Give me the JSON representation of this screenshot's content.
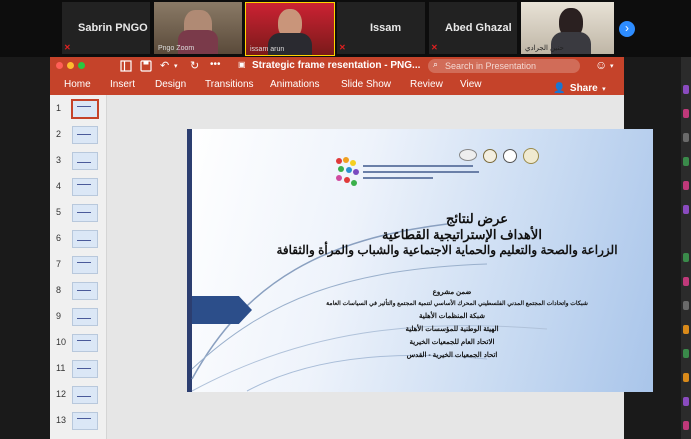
{
  "zoom": {
    "participants": [
      {
        "name": "Sabrin PNGO",
        "video": false
      },
      {
        "name": "",
        "sub": "Pngo Zoom",
        "video": true
      },
      {
        "name": "",
        "sub": "issam arun",
        "video": true
      },
      {
        "name": "Issam",
        "video": false
      },
      {
        "name": "Abed Ghazal",
        "video": false
      },
      {
        "name": "",
        "sub": "حنين الجرادي",
        "video": true
      }
    ]
  },
  "window": {
    "title": "Strategic frame resentation - PNG...",
    "search_placeholder": "Search in Presentation",
    "share_label": "Share",
    "tabs": [
      "Home",
      "Insert",
      "Design",
      "Transitions",
      "Animations",
      "Slide Show",
      "Review",
      "View"
    ]
  },
  "thumbnails": [
    "1",
    "2",
    "3",
    "4",
    "5",
    "6",
    "7",
    "8",
    "9",
    "10",
    "11",
    "12",
    "13"
  ],
  "slide": {
    "title_line1": "عرض لنتائج",
    "title_line2": "الأهداف الإستراتيجية القطاعية",
    "title_line3": "الزراعة والصحة والتعليم والحماية الاجتماعية والشباب والمرأة والثقافة",
    "sub_line1": "ضمن مشروع",
    "sub_line2": "شبكات واتحادات المجتمع المدني الفلسطيني المحرك الأساسي لتنمية المجتمع والتأثير في السياسات العامة",
    "sub_line3": "شبكة المنظمات الأهلية",
    "sub_line4": "الهيئة الوطنية للمؤسسات الأهلية",
    "sub_line5": "الاتحاد العام للجمعيات الخيرية",
    "sub_line6": "اتحاد الجمعيات الخيرية - القدس"
  },
  "colors": {
    "accent": "#c5432a",
    "zoom_blue": "#2d8cff",
    "slide_arrow": "#2c4e8a"
  }
}
